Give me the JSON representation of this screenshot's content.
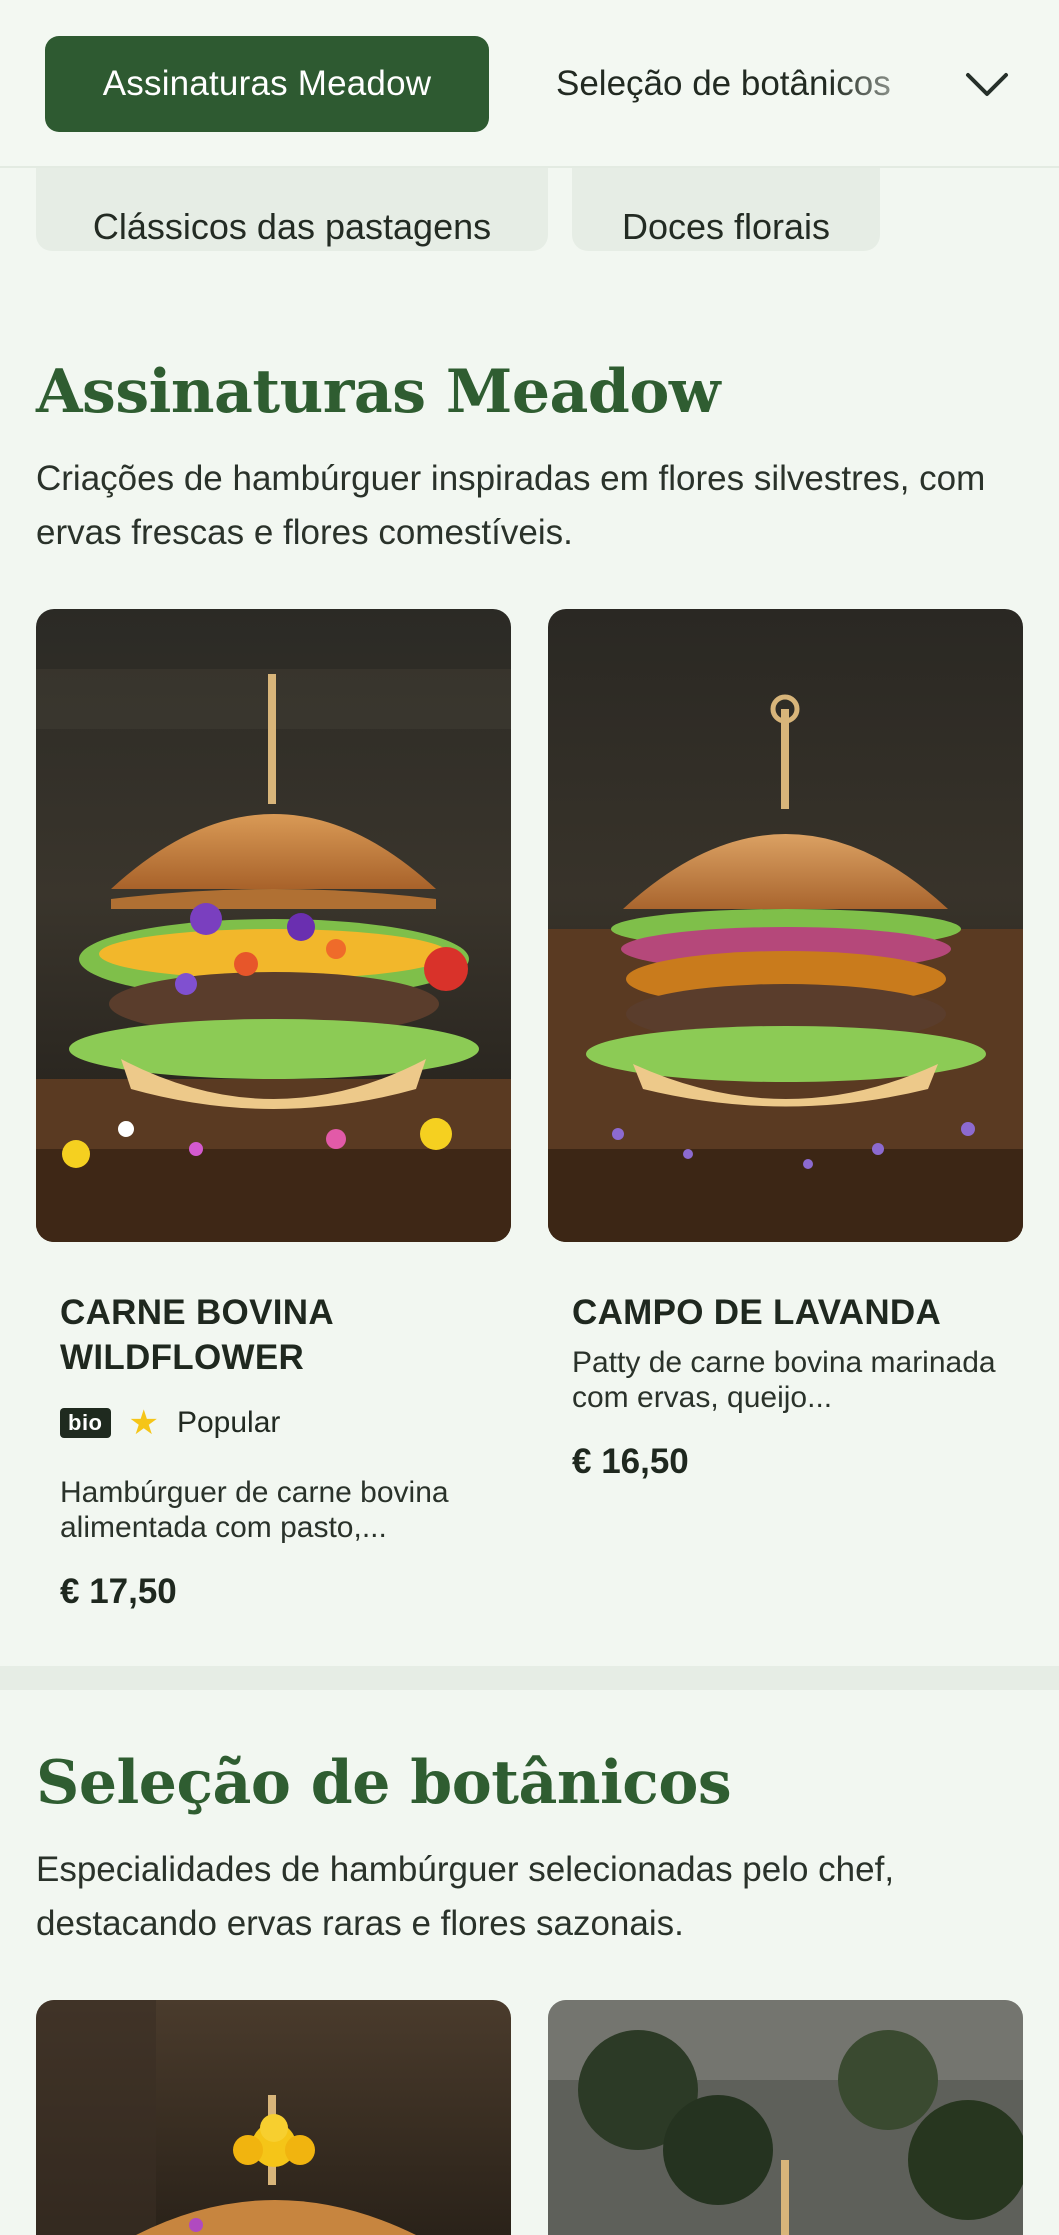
{
  "nav": {
    "active": "Assinaturas Meadow",
    "next": "Seleção de botânicos",
    "expand_icon": "chevron-down-icon"
  },
  "chips": [
    "Clássicos das pastagens",
    "Doces florais"
  ],
  "sections": [
    {
      "title": "Assinaturas Meadow",
      "description": "Criações de hambúrguer inspiradas em flores silvestres, com ervas frescas e flores comestíveis.",
      "items": [
        {
          "name": "CARNE BOVINA WILDFLOWER",
          "badge": "bio",
          "tag": "Popular",
          "description": "Hambúrguer de carne bovina alimentada com pasto,...",
          "price": "€ 17,50"
        },
        {
          "name": "CAMPO DE LAVANDA",
          "description": "Patty de carne bovina marinada com ervas, queijo...",
          "price": "€ 16,50"
        }
      ]
    },
    {
      "title": "Seleção de botânicos",
      "description": "Especialidades de hambúrguer selecionadas pelo chef, destacando ervas raras e flores sazonais."
    }
  ],
  "colors": {
    "brand_green": "#2e5a31",
    "background": "#f2f7f1",
    "star": "#f5c518"
  }
}
